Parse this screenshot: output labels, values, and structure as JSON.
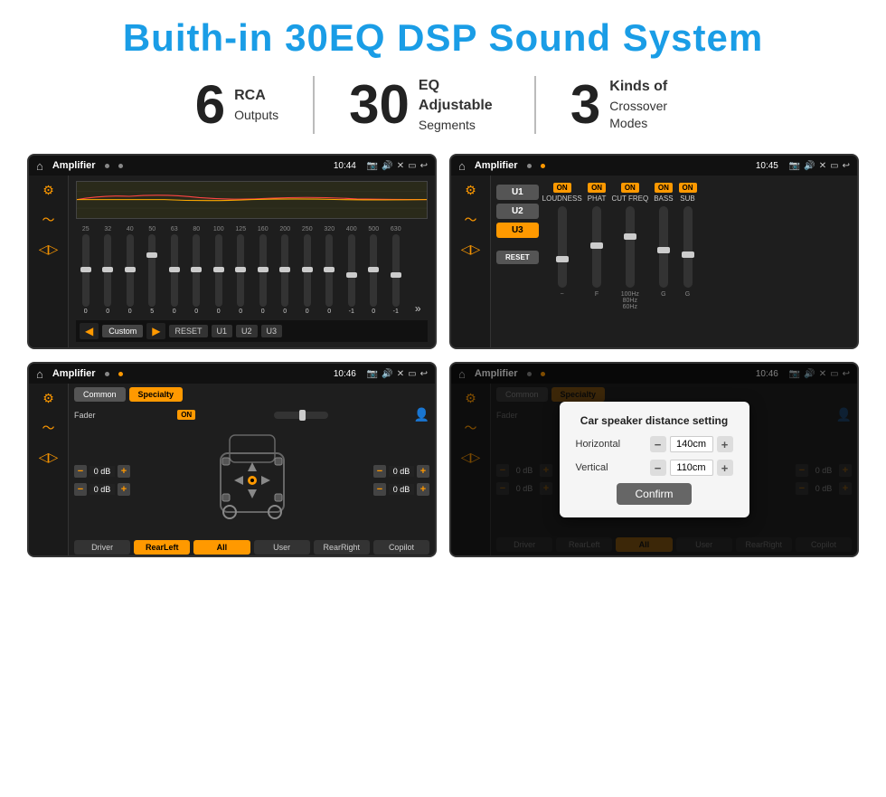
{
  "page": {
    "main_title": "Buith-in 30EQ DSP Sound System",
    "stats": [
      {
        "number": "6",
        "label_line1": "RCA",
        "label_line2": "Outputs"
      },
      {
        "number": "30",
        "label_line1": "EQ Adjustable",
        "label_line2": "Segments"
      },
      {
        "number": "3",
        "label_line1": "Kinds of",
        "label_line2": "Crossover Modes"
      }
    ],
    "screens": [
      {
        "id": "eq-screen",
        "status_bar": {
          "app_name": "Amplifier",
          "time": "10:44"
        },
        "eq_freqs": [
          "25",
          "32",
          "40",
          "50",
          "63",
          "80",
          "100",
          "125",
          "160",
          "200",
          "250",
          "320",
          "400",
          "500",
          "630"
        ],
        "eq_values": [
          "0",
          "0",
          "0",
          "5",
          "0",
          "0",
          "0",
          "0",
          "0",
          "0",
          "0",
          "0",
          "-1",
          "0",
          "-1"
        ],
        "preset": "Custom",
        "buttons": [
          "RESET",
          "U1",
          "U2",
          "U3"
        ]
      },
      {
        "id": "crossover-screen",
        "status_bar": {
          "app_name": "Amplifier",
          "time": "10:45"
        },
        "presets": [
          "U1",
          "U2",
          "U3"
        ],
        "channels": [
          {
            "name": "LOUDNESS",
            "on": true
          },
          {
            "name": "PHAT",
            "on": true
          },
          {
            "name": "CUT FREQ",
            "on": true
          },
          {
            "name": "BASS",
            "on": true
          },
          {
            "name": "SUB",
            "on": true
          }
        ],
        "reset_label": "RESET"
      },
      {
        "id": "fader-screen",
        "status_bar": {
          "app_name": "Amplifier",
          "time": "10:46"
        },
        "tabs": [
          "Common",
          "Specialty"
        ],
        "fader_label": "Fader",
        "fader_on": "ON",
        "zones": [
          {
            "label": "— 0 dB +"
          },
          {
            "label": "— 0 dB +"
          },
          {
            "label": "— 0 dB +"
          },
          {
            "label": "— 0 dB +"
          }
        ],
        "bottom_buttons": [
          "Driver",
          "RearLeft",
          "All",
          "User",
          "RearRight",
          "Copilot"
        ]
      },
      {
        "id": "dialog-screen",
        "status_bar": {
          "app_name": "Amplifier",
          "time": "10:46"
        },
        "tabs": [
          "Common",
          "Specialty"
        ],
        "dialog": {
          "title": "Car speaker distance setting",
          "horizontal_label": "Horizontal",
          "horizontal_value": "140cm",
          "vertical_label": "Vertical",
          "vertical_value": "110cm",
          "confirm_label": "Confirm"
        }
      }
    ]
  }
}
